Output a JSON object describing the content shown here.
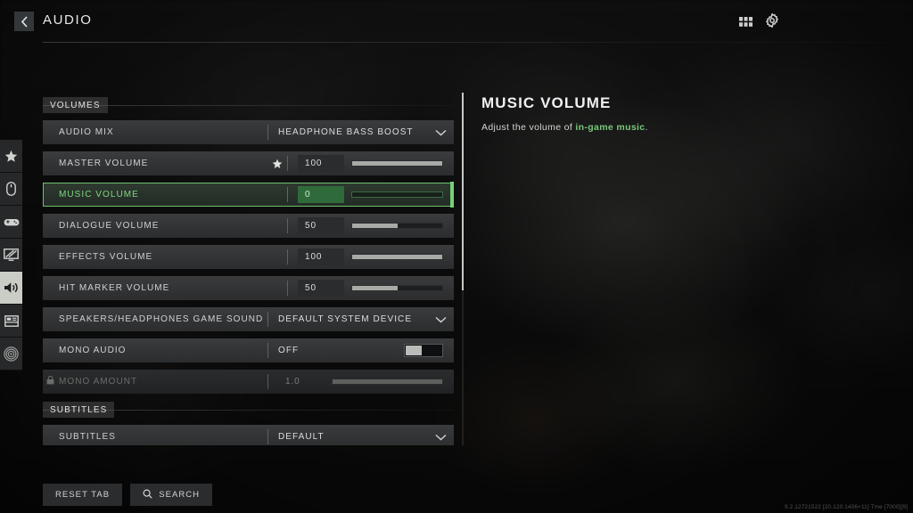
{
  "header": {
    "title": "AUDIO",
    "back_icon": "chevron-left-icon",
    "icons": [
      {
        "name": "grid-apps-icon"
      },
      {
        "name": "gear-icon"
      }
    ]
  },
  "sidebar": {
    "items": [
      {
        "name": "star-icon",
        "label": "Favorites",
        "active": false
      },
      {
        "name": "mouse-icon",
        "label": "Mouse & Keyboard",
        "active": false
      },
      {
        "name": "gamepad-icon",
        "label": "Controller",
        "active": false
      },
      {
        "name": "display-icon",
        "label": "Graphics",
        "active": false
      },
      {
        "name": "speaker-icon",
        "label": "Audio",
        "active": true
      },
      {
        "name": "interface-icon",
        "label": "Interface",
        "active": false
      },
      {
        "name": "accessibility-icon",
        "label": "Accessibility",
        "active": false
      }
    ]
  },
  "sections": [
    {
      "title": "VOLUMES",
      "rows": [
        {
          "type": "dropdown",
          "label": "AUDIO MIX",
          "value": "HEADPHONE BASS BOOST",
          "selected": false,
          "disabled": false
        },
        {
          "type": "slider",
          "label": "MASTER VOLUME",
          "value": "100",
          "fill_pct": 100,
          "favorite": true,
          "selected": false,
          "disabled": false
        },
        {
          "type": "slider",
          "label": "MUSIC VOLUME",
          "value": "0",
          "fill_pct": 0,
          "favorite": false,
          "selected": true,
          "disabled": false
        },
        {
          "type": "slider",
          "label": "DIALOGUE VOLUME",
          "value": "50",
          "fill_pct": 50,
          "favorite": false,
          "selected": false,
          "disabled": false
        },
        {
          "type": "slider",
          "label": "EFFECTS VOLUME",
          "value": "100",
          "fill_pct": 100,
          "favorite": false,
          "selected": false,
          "disabled": false
        },
        {
          "type": "slider",
          "label": "HIT MARKER VOLUME",
          "value": "50",
          "fill_pct": 50,
          "favorite": false,
          "selected": false,
          "disabled": false
        },
        {
          "type": "dropdown",
          "label": "SPEAKERS/HEADPHONES GAME SOUND DEVICE",
          "value": "DEFAULT SYSTEM DEVICE",
          "selected": false,
          "disabled": false
        },
        {
          "type": "toggle",
          "label": "MONO AUDIO",
          "value": "OFF",
          "on": false,
          "selected": false,
          "disabled": false
        },
        {
          "type": "slider",
          "label": "MONO AMOUNT",
          "value": "1.0",
          "fill_pct": 100,
          "favorite": false,
          "selected": false,
          "disabled": true,
          "lock_icon": "lock-icon"
        }
      ]
    },
    {
      "title": "SUBTITLES",
      "rows": [
        {
          "type": "dropdown",
          "label": "SUBTITLES",
          "value": "DEFAULT",
          "selected": false,
          "disabled": false
        }
      ]
    }
  ],
  "detail": {
    "title": "MUSIC VOLUME",
    "desc_before": "Adjust the volume of ",
    "desc_highlight": "in-game music",
    "desc_after": "."
  },
  "footer": {
    "reset_label": "RESET TAB",
    "search_label": "SEARCH",
    "search_icon": "magnifier-icon"
  },
  "version": "9.2.12721522 [20.120:1406+11] Tme [7000][9]",
  "colors": {
    "accent_green": "#76d076",
    "row_bg": "#313335",
    "rail_active": "#c9cdc6"
  }
}
